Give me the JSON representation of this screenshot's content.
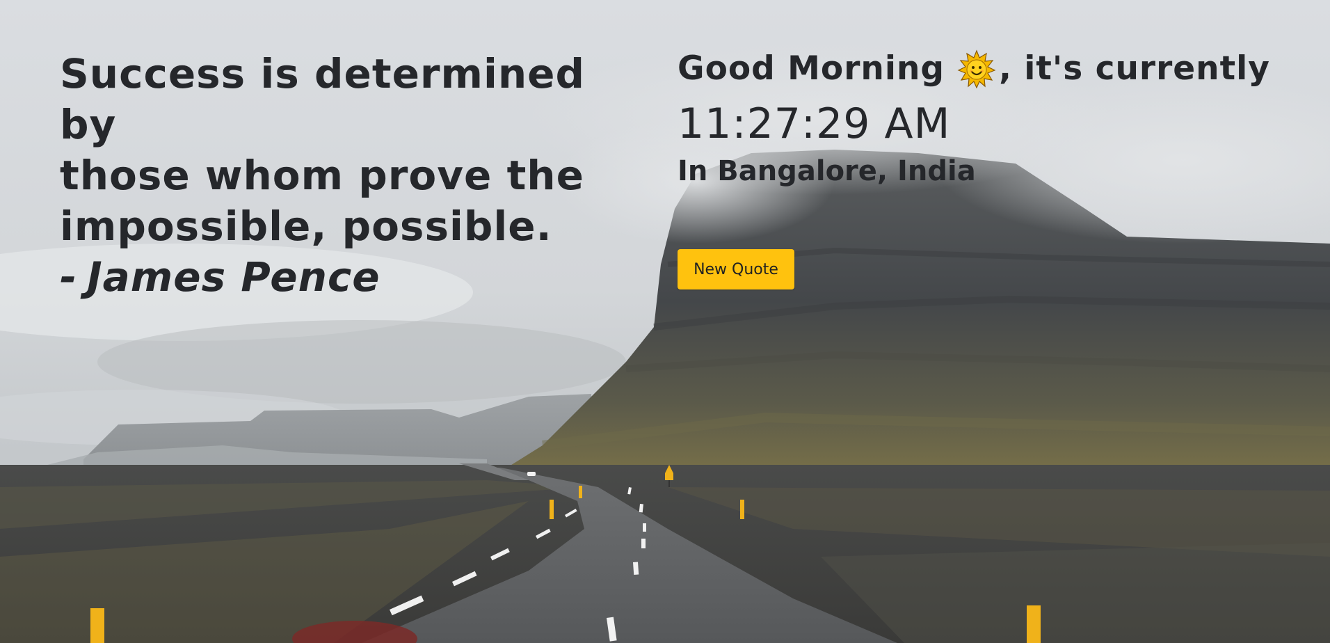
{
  "quote": {
    "lines": [
      "Success is determined by",
      "those whom prove the",
      "impossible, possible."
    ],
    "dash": "-",
    "author": "James Pence"
  },
  "clock": {
    "greeting_prefix": "Good Morning",
    "greeting_icon": "sun-face-icon",
    "greeting_suffix": ", it's currently",
    "time": "11:27:29 AM",
    "location": "In Bangalore, India"
  },
  "actions": {
    "new_quote_label": "New Quote"
  },
  "colors": {
    "text": "#25272b",
    "button": "#ffc20e",
    "sky": "#d6d9dc"
  }
}
